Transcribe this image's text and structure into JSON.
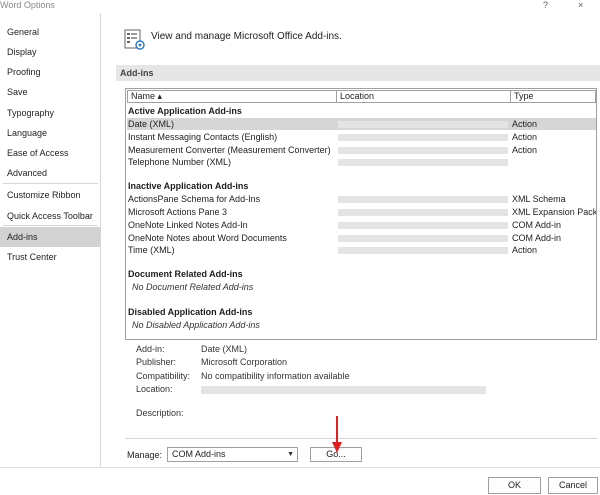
{
  "window": {
    "title": "Word Options",
    "help_glyph": "?",
    "close_glyph": "×"
  },
  "sidebar": {
    "items": [
      {
        "label": "General"
      },
      {
        "label": "Display"
      },
      {
        "label": "Proofing"
      },
      {
        "label": "Save"
      },
      {
        "label": "Typography"
      },
      {
        "label": "Language"
      },
      {
        "label": "Ease of Access"
      },
      {
        "label": "Advanced"
      },
      {
        "label": "Customize Ribbon"
      },
      {
        "label": "Quick Access Toolbar"
      },
      {
        "label": "Add-ins",
        "selected": true
      },
      {
        "label": "Trust Center"
      }
    ]
  },
  "main": {
    "header": "View and manage Microsoft Office Add-ins.",
    "section_title": "Add-ins",
    "columns": {
      "name": "Name ▴",
      "location": "Location",
      "type": "Type"
    },
    "groups": {
      "active": "Active Application Add-ins",
      "inactive": "Inactive Application Add-ins",
      "document": "Document Related Add-ins",
      "disabled": "Disabled Application Add-ins"
    },
    "active_rows": [
      {
        "name": "Date (XML)",
        "type": "Action",
        "selected": true
      },
      {
        "name": "Instant Messaging Contacts (English)",
        "type": "Action"
      },
      {
        "name": "Measurement Converter (Measurement Converter)",
        "type": "Action"
      },
      {
        "name": "Telephone Number (XML)",
        "type": ""
      }
    ],
    "inactive_rows": [
      {
        "name": "ActionsPane Schema for Add-Ins",
        "type": "XML Schema"
      },
      {
        "name": "Microsoft Actions Pane 3",
        "type": "XML Expansion Pack"
      },
      {
        "name": "OneNote Linked Notes Add-In",
        "type": "COM Add-in"
      },
      {
        "name": "OneNote Notes about Word Documents",
        "type": "COM Add-in"
      },
      {
        "name": "Time (XML)",
        "type": "Action"
      }
    ],
    "document_empty": "No Document Related Add-ins",
    "disabled_empty": "No Disabled Application Add-ins",
    "details": {
      "addin_label": "Add-in:",
      "addin_value": "Date (XML)",
      "publisher_label": "Publisher:",
      "publisher_value": "Microsoft Corporation",
      "compat_label": "Compatibility:",
      "compat_value": "No compatibility information available",
      "location_label": "Location:",
      "description_label": "Description:",
      "description_value": ""
    },
    "manage": {
      "label": "Manage:",
      "selected": "COM Add-ins",
      "go_label": "Go..."
    }
  },
  "footer": {
    "ok_label": "OK",
    "cancel_label": "Cancel"
  },
  "colors": {
    "selected_nav": "#d2d2d2",
    "selected_row": "#d6d6d6",
    "section_bar": "#e6e6e6",
    "arrow": "#e02020"
  }
}
